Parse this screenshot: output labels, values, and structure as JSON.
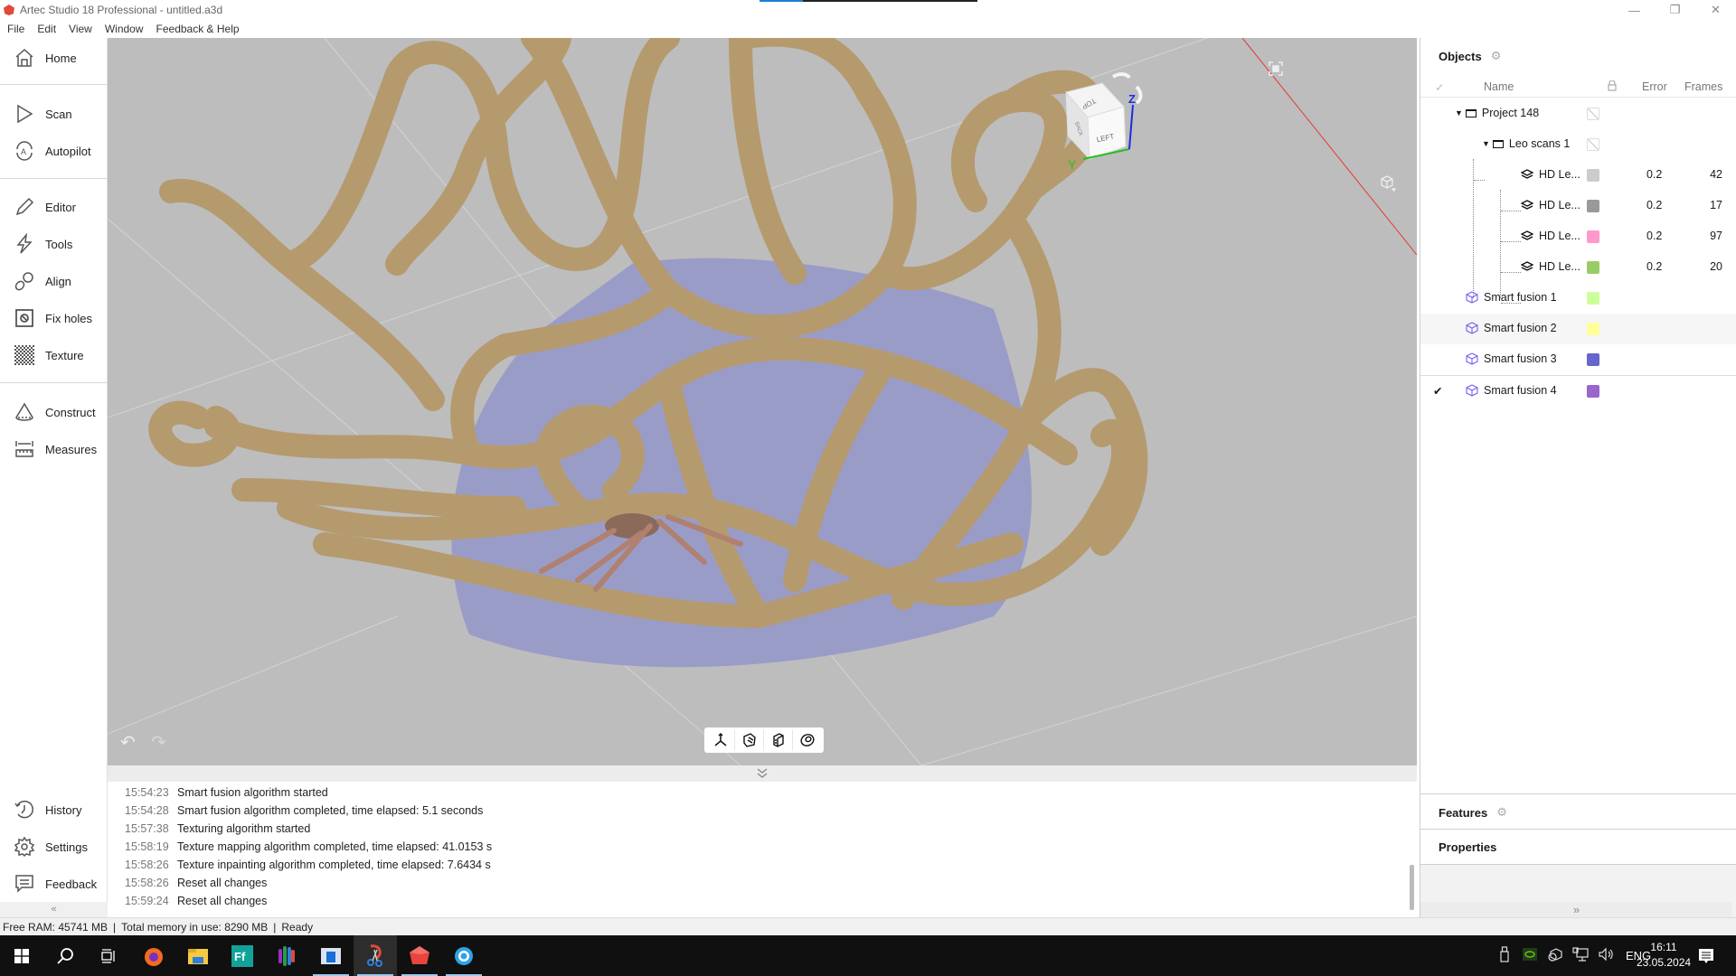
{
  "window": {
    "title": "Artec Studio 18 Professional - untitled.a3d",
    "progress_fraction": 0.2,
    "controls": {
      "minimize": "—",
      "restore": "❐",
      "close": "✕"
    }
  },
  "menu": [
    "File",
    "Edit",
    "View",
    "Window",
    "Feedback & Help"
  ],
  "sidebar": {
    "items": [
      {
        "label": "Home",
        "icon": "home-icon"
      },
      {
        "label": "Scan",
        "icon": "scan-play-icon"
      },
      {
        "label": "Autopilot",
        "icon": "autopilot-icon"
      },
      {
        "label": "Editor",
        "icon": "pencil-icon"
      },
      {
        "label": "Tools",
        "icon": "lightning-icon"
      },
      {
        "label": "Align",
        "icon": "align-icon"
      },
      {
        "label": "Fix holes",
        "icon": "fix-holes-icon"
      },
      {
        "label": "Texture",
        "icon": "texture-checker-icon"
      },
      {
        "label": "Construct",
        "icon": "cone-icon"
      },
      {
        "label": "Measures",
        "icon": "ruler-icon"
      },
      {
        "label": "History",
        "icon": "history-icon"
      },
      {
        "label": "Settings",
        "icon": "gear-icon"
      },
      {
        "label": "Feedback",
        "icon": "feedback-icon"
      }
    ],
    "collapse_glyph": "«"
  },
  "viewport": {
    "view_cube": {
      "top_face": "TOP",
      "front_face": "LEFT",
      "side_face": "BACK",
      "axis_y": "Y",
      "axis_z": "Z"
    },
    "axis_colors": {
      "x": "#e53935",
      "y": "#22c022",
      "z": "#1a2ee0"
    },
    "background": "#bdbdbd",
    "model_color": "#b79a70",
    "underside_color": "#9a9cc8",
    "tools": [
      "axes-icon",
      "solid-shading-icon",
      "texture-shading-icon",
      "surface-rings-icon"
    ],
    "undo_glyph": "↶",
    "redo_glyph": "↷"
  },
  "log": {
    "toggle_glyph": "⌄",
    "entries": [
      {
        "time": "15:54:23",
        "message": "Smart fusion algorithm started"
      },
      {
        "time": "15:54:28",
        "message": "Smart fusion algorithm completed, time elapsed: 5.1 seconds"
      },
      {
        "time": "15:57:38",
        "message": "Texturing algorithm started"
      },
      {
        "time": "15:58:19",
        "message": "Texture mapping algorithm completed, time elapsed: 41.0153 s"
      },
      {
        "time": "15:58:26",
        "message": "Texture inpainting algorithm completed, time elapsed: 7.6434 s"
      },
      {
        "time": "15:58:26",
        "message": "Reset all changes"
      },
      {
        "time": "15:59:24",
        "message": "Reset all changes"
      }
    ]
  },
  "status": {
    "free_ram": "Free RAM: 45741 MB",
    "total_memory": "Total memory in use: 8290 MB",
    "state": "Ready",
    "sep": "|"
  },
  "objects_panel": {
    "title": "Objects",
    "columns": {
      "check": "✓",
      "name": "Name",
      "lock": "lock-icon",
      "error": "Error",
      "frames": "Frames"
    },
    "rows": [
      {
        "name": "Project 148",
        "type": "folder",
        "level": 0,
        "color": null,
        "error": "",
        "frames": "",
        "checked": false
      },
      {
        "name": "Leo scans 1",
        "type": "folder",
        "level": 1,
        "color": null,
        "error": "",
        "frames": "",
        "checked": false
      },
      {
        "name": "HD Le...",
        "type": "scan",
        "level": 2,
        "color": "#cccccc",
        "error": "0.2",
        "frames": "42",
        "checked": false
      },
      {
        "name": "HD Le...",
        "type": "scan",
        "level": 2,
        "color": "#999999",
        "error": "0.2",
        "frames": "17",
        "checked": false
      },
      {
        "name": "HD Le...",
        "type": "scan",
        "level": 2,
        "color": "#ff99cc",
        "error": "0.2",
        "frames": "97",
        "checked": false
      },
      {
        "name": "HD Le...",
        "type": "scan",
        "level": 2,
        "color": "#99cc66",
        "error": "0.2",
        "frames": "20",
        "checked": false
      },
      {
        "name": "Smart fusion 1",
        "type": "model",
        "level": 0,
        "color": "#ccff99",
        "error": "",
        "frames": "",
        "checked": false
      },
      {
        "name": "Smart fusion 2",
        "type": "model",
        "level": 0,
        "color": "#ffff99",
        "error": "",
        "frames": "",
        "checked": false,
        "hovered": true
      },
      {
        "name": "Smart fusion 3",
        "type": "model",
        "level": 0,
        "color": "#6666cc",
        "error": "",
        "frames": "",
        "checked": false
      },
      {
        "name": "Smart fusion 4",
        "type": "model",
        "level": 0,
        "color": "#9966cc",
        "error": "",
        "frames": "",
        "checked": true
      }
    ]
  },
  "features_panel": {
    "title": "Features"
  },
  "properties_panel": {
    "title": "Properties"
  },
  "right_collapse_glyph": "»",
  "taskbar": {
    "apps": [
      {
        "name": "start",
        "icon": "windows-start-icon"
      },
      {
        "name": "search",
        "icon": "search-icon"
      },
      {
        "name": "task-view",
        "icon": "task-view-icon"
      },
      {
        "name": "firefox",
        "icon": "firefox-icon"
      },
      {
        "name": "file-explorer",
        "icon": "folder-icon"
      },
      {
        "name": "fastreport",
        "icon": "ff-app-icon"
      },
      {
        "name": "color-app",
        "icon": "color-bars-icon"
      },
      {
        "name": "window-app",
        "icon": "window-app-icon"
      },
      {
        "name": "snipping-tool",
        "icon": "scissors-icon",
        "active": true
      },
      {
        "name": "artec-studio",
        "icon": "artec-icon"
      },
      {
        "name": "browser",
        "icon": "browser-icon"
      }
    ],
    "tray": {
      "language": "ENG",
      "time": "16:11",
      "date": "23.05.2024"
    }
  }
}
